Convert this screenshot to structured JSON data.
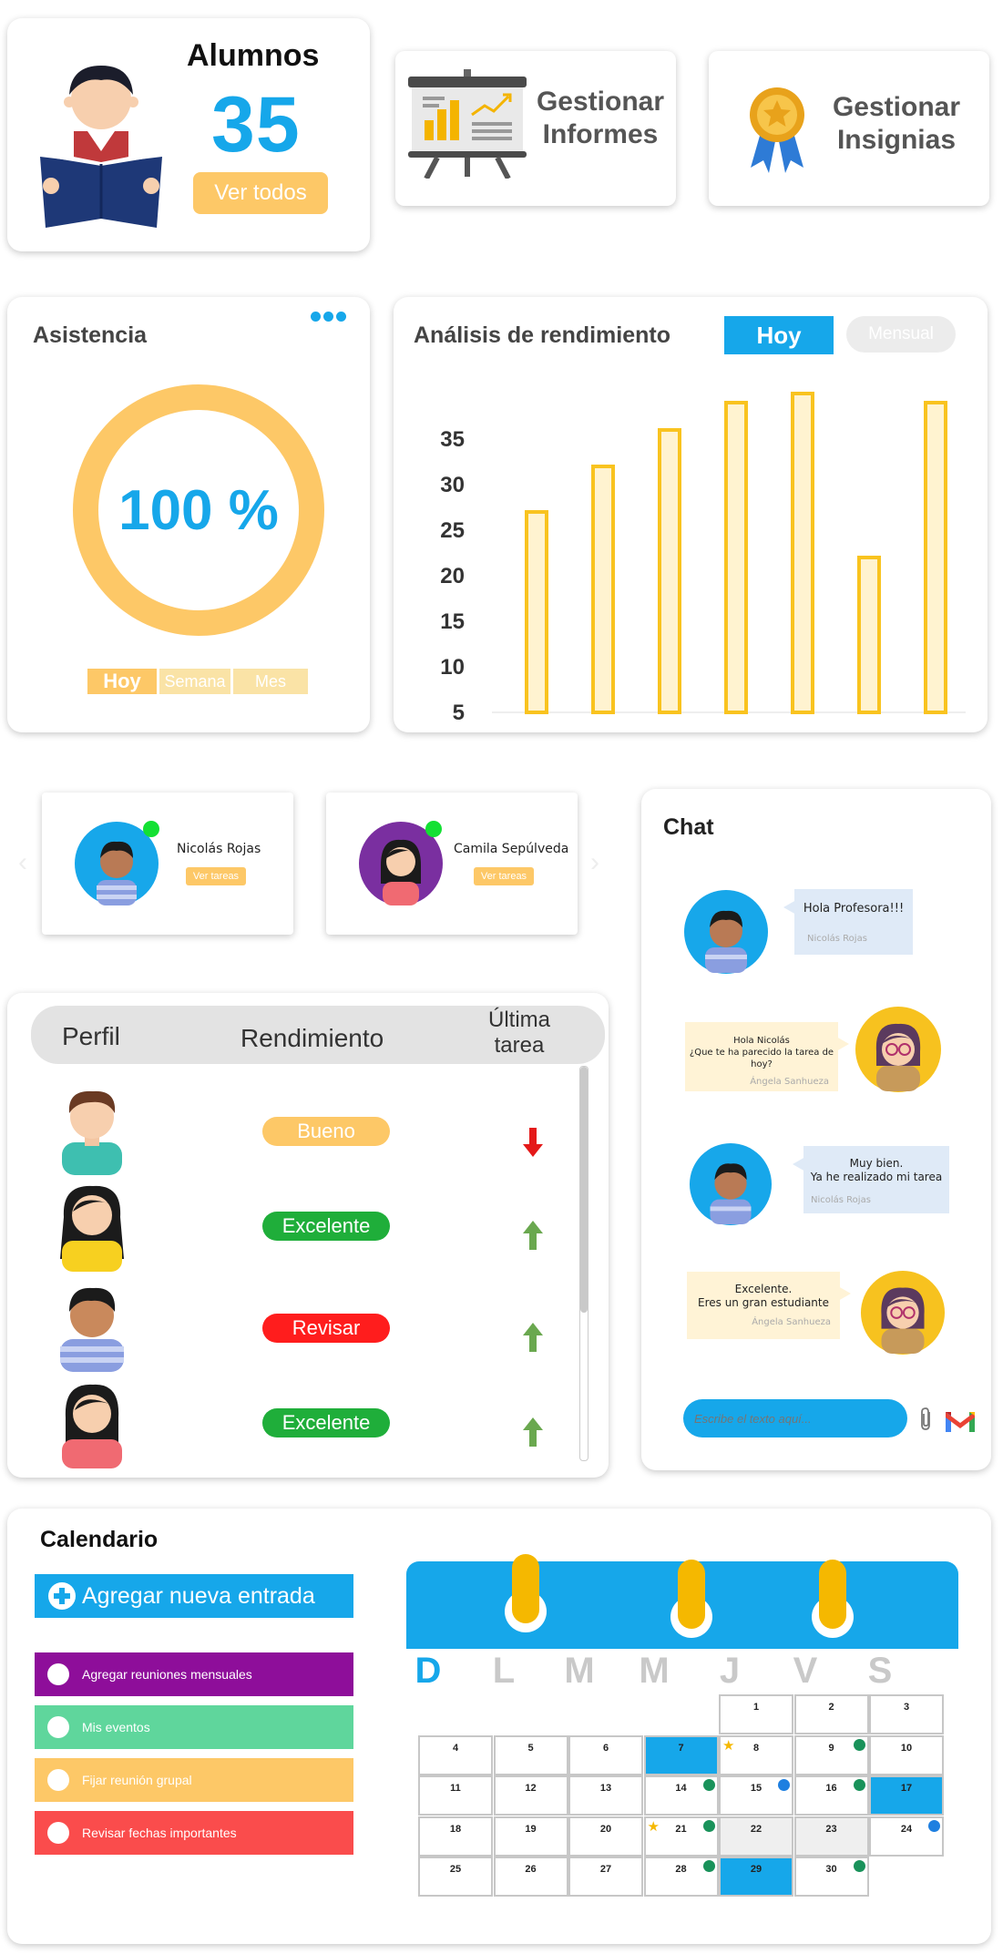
{
  "alumnos": {
    "title": "Alumnos",
    "count": "35",
    "view_all": "Ver todos"
  },
  "informes": {
    "label_line1": "Gestionar",
    "label_line2": "Informes"
  },
  "insignias": {
    "label_line1": "Gestionar",
    "label_line2": "Insignias"
  },
  "asistencia": {
    "title": "Asistencia",
    "value": "100 %",
    "percent": 100,
    "tabs": [
      "Hoy",
      "Semana",
      "Mes"
    ],
    "colors": {
      "ring": "#fdc867",
      "value": "#16a7ea",
      "tab_active": "#fdc867",
      "tab_inactive": "#fae3a6"
    }
  },
  "rendimiento": {
    "title": "Análisis de rendimiento",
    "toggle": {
      "active": "Hoy",
      "inactive": "Mensual"
    }
  },
  "chart_data": {
    "type": "bar",
    "title": "Análisis de rendimiento",
    "categories": [
      "",
      "",
      "",
      "",
      "",
      "",
      ""
    ],
    "values": [
      25,
      30,
      34,
      37,
      38,
      20,
      37
    ],
    "yticks": [
      "35",
      "30",
      "25",
      "20",
      "15",
      "10",
      "5"
    ],
    "ylim": [
      2,
      38
    ],
    "colors": {
      "fill": "#fff3d0",
      "stroke": "#f9c31f"
    },
    "grid": false,
    "legend": "none"
  },
  "students": [
    {
      "name": "Nicolás Rojas",
      "action": "Ver tareas",
      "online": true
    },
    {
      "name": "Camila Sepúlveda",
      "action": "Ver tareas",
      "online": true
    }
  ],
  "performance_table": {
    "headers": {
      "perfil": "Perfil",
      "rendimiento": "Rendimiento",
      "ultima_line1": "Última",
      "ultima_line2": "tarea"
    },
    "rows": [
      {
        "rendimiento": "Bueno",
        "color": "#fdc867",
        "trend": "down"
      },
      {
        "rendimiento": "Excelente",
        "color": "#1fae3a",
        "trend": "up"
      },
      {
        "rendimiento": "Revisar",
        "color": "#ff1d1d",
        "trend": "up"
      },
      {
        "rendimiento": "Excelente",
        "color": "#1fae3a",
        "trend": "up"
      }
    ]
  },
  "chat": {
    "title": "Chat",
    "messages": [
      {
        "lines": [
          "Hola Profesora!!!"
        ],
        "sender": "Nicolás Rojas",
        "from": "student"
      },
      {
        "lines": [
          "Hola Nicolás",
          "¿Que te ha parecido la tarea de hoy?"
        ],
        "sender": "Ángela Sanhueza",
        "from": "teacher"
      },
      {
        "lines": [
          "Muy bien.",
          "Ya he realizado mi tarea"
        ],
        "sender": "Nicolás Rojas",
        "from": "student"
      },
      {
        "lines": [
          "Excelente.",
          "Eres un gran estudiante"
        ],
        "sender": "Ángela Sanhueza",
        "from": "teacher"
      }
    ],
    "input_placeholder": "Escribe el texto aquí...",
    "icons": [
      "paperclip-icon",
      "gmail-icon"
    ]
  },
  "calendario": {
    "title": "Calendario",
    "add_entry": "Agregar nueva entrada",
    "entries": [
      {
        "label": "Agregar reuniones mensuales",
        "color": "#8e0e9a"
      },
      {
        "label": "Mis eventos",
        "color": "#5fd69c"
      },
      {
        "label": "Fijar reunión grupal",
        "color": "#fdc867"
      },
      {
        "label": "Revisar fechas importantes",
        "color": "#fa4c4c"
      }
    ],
    "weekdays": [
      "D",
      "L",
      "M",
      "M",
      "J",
      "V",
      "S"
    ],
    "days": [
      "1",
      "2",
      "3",
      "4",
      "5",
      "6",
      "7",
      "8",
      "9",
      "10",
      "11",
      "12",
      "13",
      "14",
      "15",
      "16",
      "17",
      "18",
      "19",
      "20",
      "21",
      "22",
      "23",
      "24",
      "25",
      "26",
      "27",
      "28",
      "29",
      "30"
    ],
    "highlighted": [
      "7",
      "17",
      "29"
    ],
    "grey": [
      "22",
      "23"
    ],
    "starred": [
      "8",
      "21"
    ],
    "chat_marks": [
      "9",
      "14",
      "16",
      "21",
      "28",
      "30"
    ],
    "blue_marks": [
      "15",
      "24"
    ]
  }
}
